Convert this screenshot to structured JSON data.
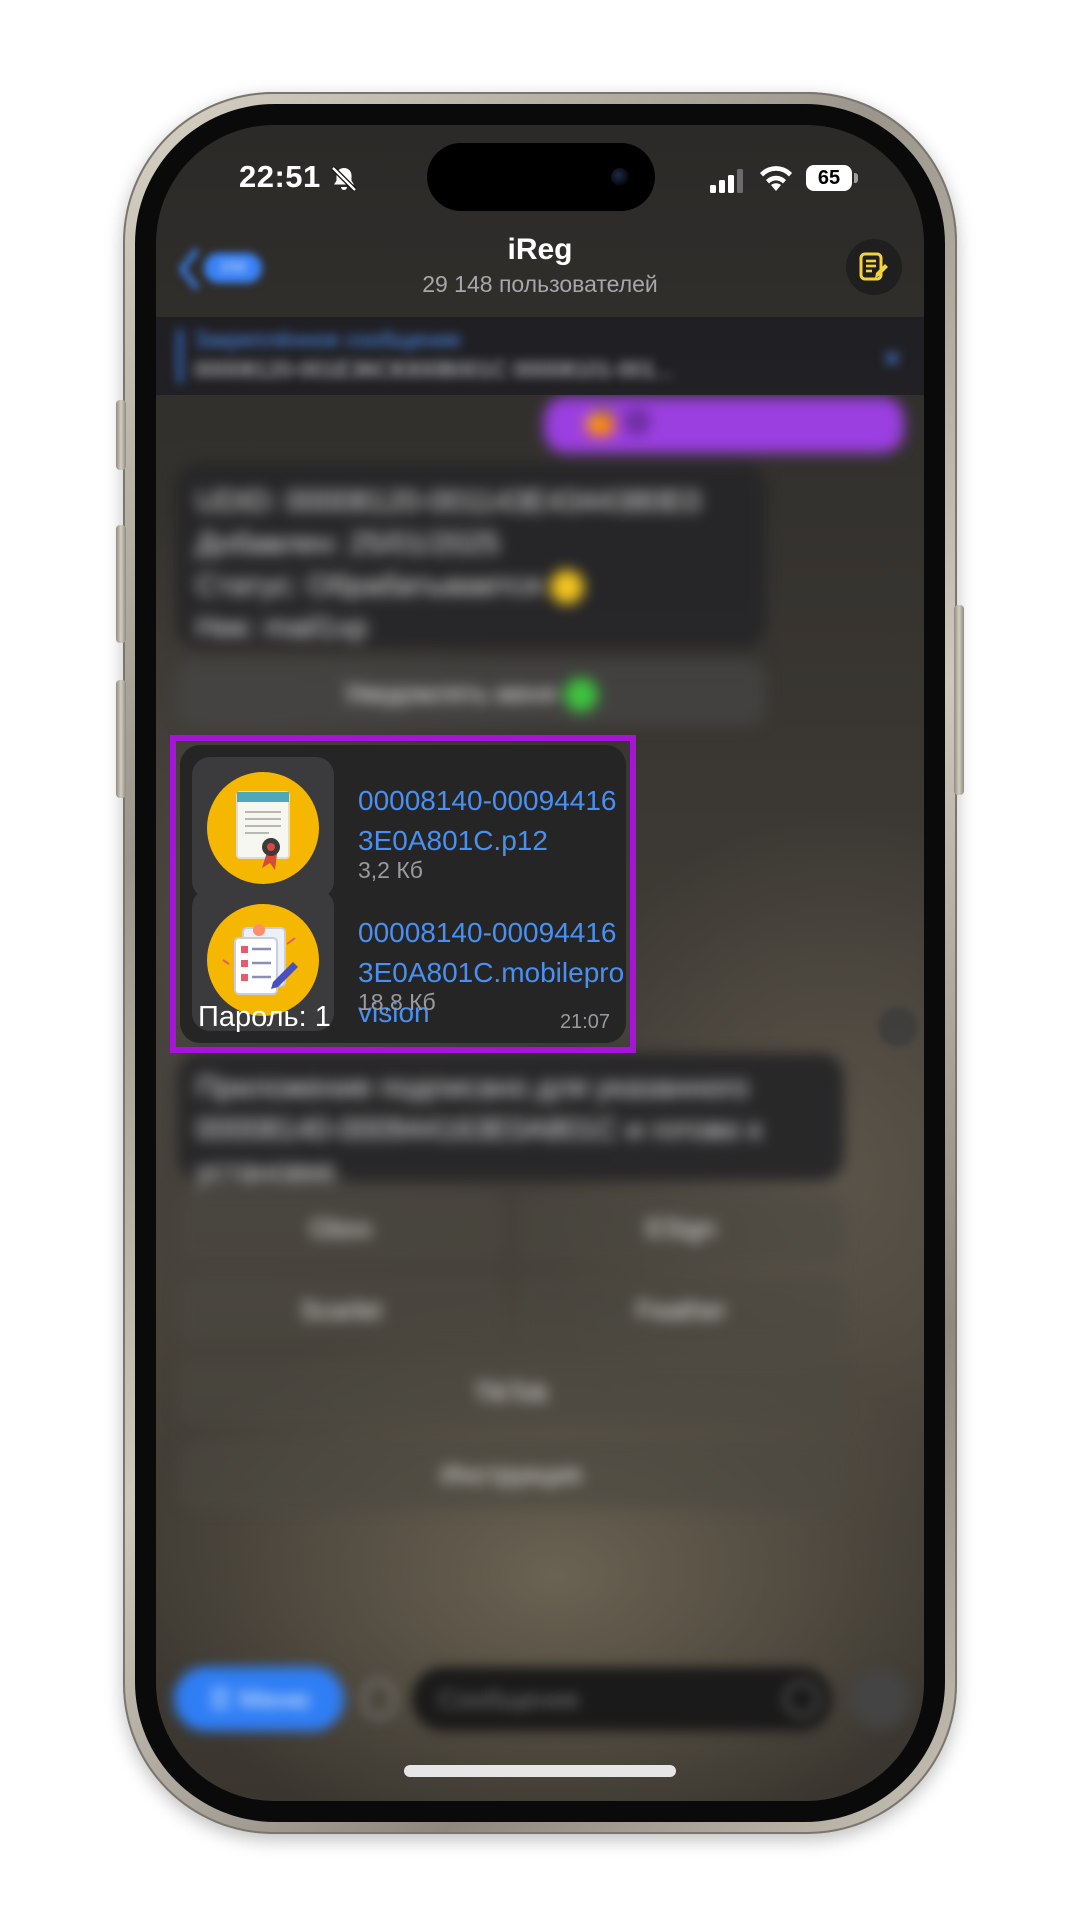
{
  "status_bar": {
    "time": "22:51",
    "battery": "65",
    "icons": [
      "bell-slash-icon",
      "signal-icon",
      "wifi-icon",
      "battery-icon"
    ]
  },
  "header": {
    "back_badge": "150",
    "title": "iReg",
    "subtitle": "29 148 пользователей",
    "edit_icon": "note-edit-icon",
    "accent_color": "#f5d33a"
  },
  "pinned": {
    "title": "Закреплённое сообщение",
    "text": "00008120-001E36C8300B001C 00008101-001..."
  },
  "background_messages": {
    "outgoing_emojis": "🍊 😊",
    "status_lines": [
      "UDID: 00008120-001143E4344380E0",
      "Добавлен: 25/01/2025",
      "Статус: Обрабатывается",
      "Ник: mail1xp"
    ],
    "notify_button": "Уведомлять меня",
    "signed_text": "Приложение подписано для указанного 00008140-000944163E0A801C и готово к установке.",
    "keyboard_buttons": [
      "Gbox",
      "ESign",
      "Scarlet",
      "Feather",
      "TikTok",
      "Инструкция"
    ]
  },
  "file_message": {
    "files": [
      {
        "name": "00008140-000944163E0A801C.p12",
        "size": "3,2 Кб",
        "icon": "certificate-icon"
      },
      {
        "name": "00008140-000944163E0A801C.mobileprovision",
        "size": "18,8 Кб",
        "icon": "checklist-document-icon"
      }
    ],
    "caption": "Пароль: 1",
    "time": "21:07",
    "highlight_color": "#a415d8",
    "link_color": "#4a90f0"
  },
  "composer": {
    "menu_label": "☰ Меню",
    "input_placeholder": "Сообщение"
  }
}
